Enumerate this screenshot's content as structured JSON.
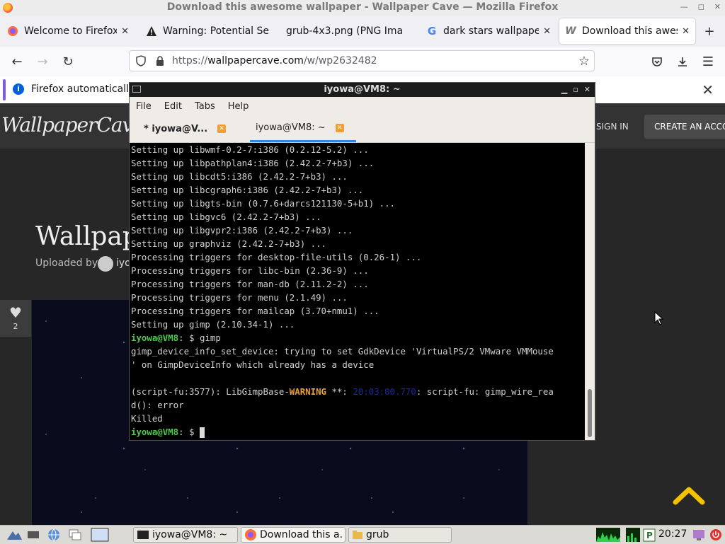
{
  "firefox": {
    "window_title": "Download this awesome wallpaper - Wallpaper Cave — Mozilla Firefox",
    "tabs": [
      {
        "label": "Welcome to Firefox",
        "icon": "firefox-icon",
        "active": false
      },
      {
        "label": "Warning: Potential Se",
        "icon": "warning-icon",
        "active": false
      },
      {
        "label": "grub-4x3.png (PNG Ima",
        "icon": "none",
        "active": false
      },
      {
        "label": "dark stars wallpaper",
        "icon": "google-icon",
        "active": false
      },
      {
        "label": "Download this aweso",
        "icon": "wallpapercave-icon",
        "active": true
      }
    ],
    "new_tab": "+",
    "tab_overflow": "⌄",
    "url_host": "wallpapercave.com",
    "url_prefix": "https://",
    "url_path": "/w/wp2632482",
    "notification": "Firefox automatically"
  },
  "page": {
    "logo": "WallpaperCave",
    "sign_in": "SIGN IN",
    "create_account": "CREATE AN ACCO",
    "title": "Wallpape",
    "uploaded_by": "Uploaded by",
    "uploader": "iyo",
    "like_count": "2"
  },
  "terminal": {
    "title": "iyowa@VM8: ~",
    "menu": [
      "File",
      "Edit",
      "Tabs",
      "Help"
    ],
    "tabs": [
      {
        "label": "* iyowa@V...",
        "active": false
      },
      {
        "label": "iyowa@VM8: ~",
        "active": true
      }
    ],
    "lines": [
      "Setting up libwmf-0.2-7:i386 (0.2.12-5.2) ...",
      "Setting up libpathplan4:i386 (2.42.2-7+b3) ...",
      "Setting up libcdt5:i386 (2.42.2-7+b3) ...",
      "Setting up libcgraph6:i386 (2.42.2-7+b3) ...",
      "Setting up libgts-bin (0.7.6+darcs121130-5+b1) ...",
      "Setting up libgvc6 (2.42.2-7+b3) ...",
      "Setting up libgvpr2:i386 (2.42.2-7+b3) ...",
      "Setting up graphviz (2.42.2-7+b3) ...",
      "Processing triggers for desktop-file-utils (0.26-1) ...",
      "Processing triggers for libc-bin (2.36-9) ...",
      "Processing triggers for man-db (2.11.2-2) ...",
      "Processing triggers for menu (2.1.49) ...",
      "Processing triggers for mailcap (3.70+nmu1) ...",
      "Setting up gimp (2.10.34-1) ..."
    ],
    "prompt": "iyowa@VM8",
    "prompt_suffix": ": $ ",
    "command": "gimp",
    "err1": "gimp_device_info_set_device: trying to set GdkDevice 'VirtualPS/2 VMware VMMouse",
    "err2": "' on GimpDeviceInfo which already has a device",
    "warn_prefix": "(script-fu:3577): LibGimpBase-",
    "warn_word": "WARNING",
    "warn_stars": " **: ",
    "warn_time": "20:03:00.770",
    "warn_msg": ": script-fu: gimp_wire_rea",
    "warn_cont": "d(): error",
    "killed": "Killed"
  },
  "taskbar": {
    "tasks": [
      {
        "label": "iyowa@VM8: ~",
        "icon": "terminal-icon"
      },
      {
        "label": "Download this a...",
        "icon": "firefox-icon"
      },
      {
        "label": "grub",
        "icon": "folder-icon"
      }
    ],
    "clock": "20:27"
  },
  "colors": {
    "prompt_green": "#4ec94e",
    "warning_orange": "#e8a33a",
    "scroll_up_yellow": "#f2c200",
    "tab_accent": "#3584e4"
  }
}
